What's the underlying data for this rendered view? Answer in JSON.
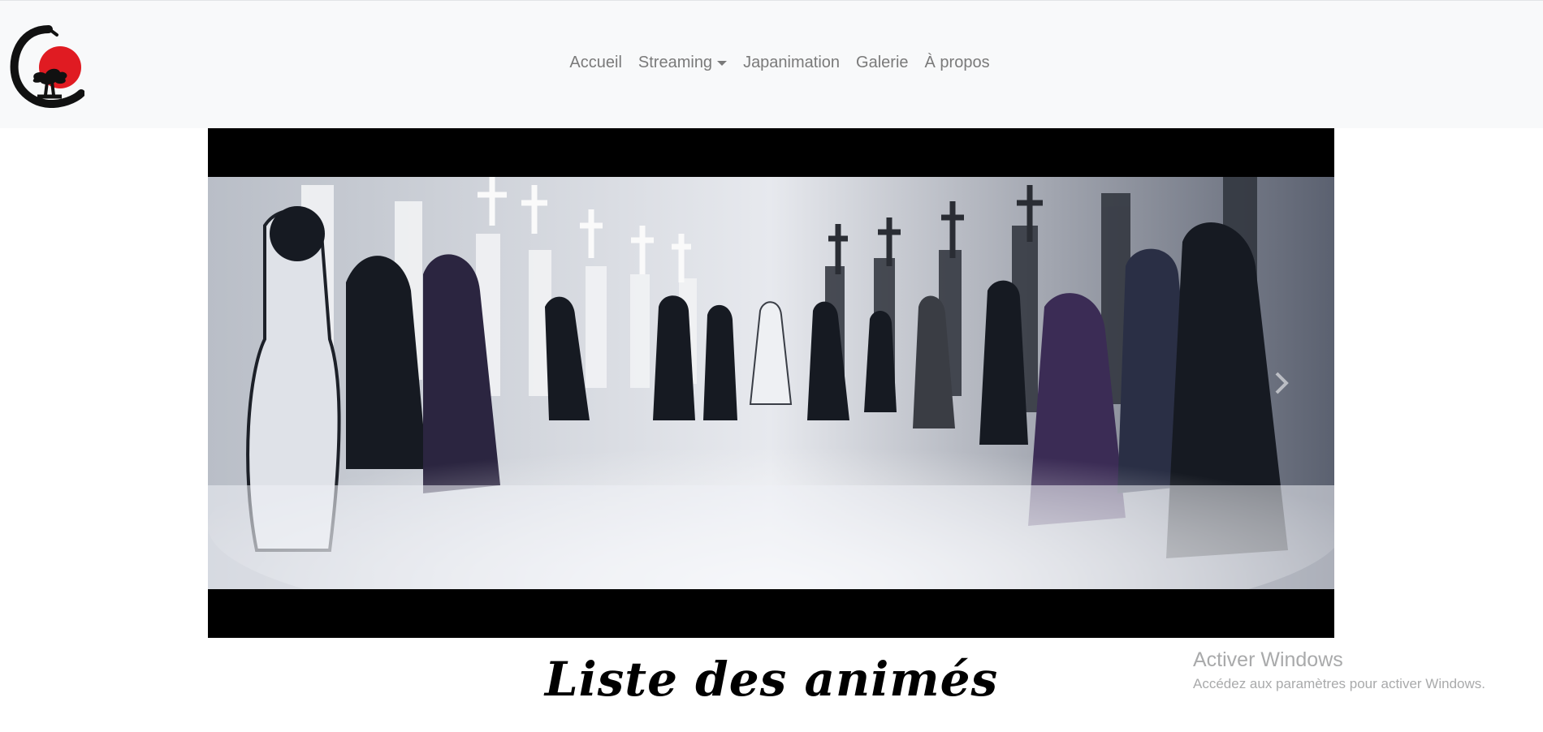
{
  "nav": {
    "items": [
      {
        "label": "Accueil",
        "dropdown": false
      },
      {
        "label": "Streaming",
        "dropdown": true
      },
      {
        "label": "Japanimation",
        "dropdown": false
      },
      {
        "label": "Galerie",
        "dropdown": false
      },
      {
        "label": "À propos",
        "dropdown": false
      }
    ]
  },
  "main": {
    "heading": "Liste des animés"
  },
  "os_watermark": {
    "title": "Activer Windows",
    "subtitle": "Accédez aux paramètres pour activer Windows."
  },
  "colors": {
    "navbar_bg": "#f8f9fa",
    "nav_link": "#7a7a7a",
    "logo_sun": "#e01b22",
    "letterbox": "#000000"
  },
  "icons": [
    "logo-enso-bonsai-icon",
    "chevron-right-icon",
    "caret-down-icon"
  ]
}
